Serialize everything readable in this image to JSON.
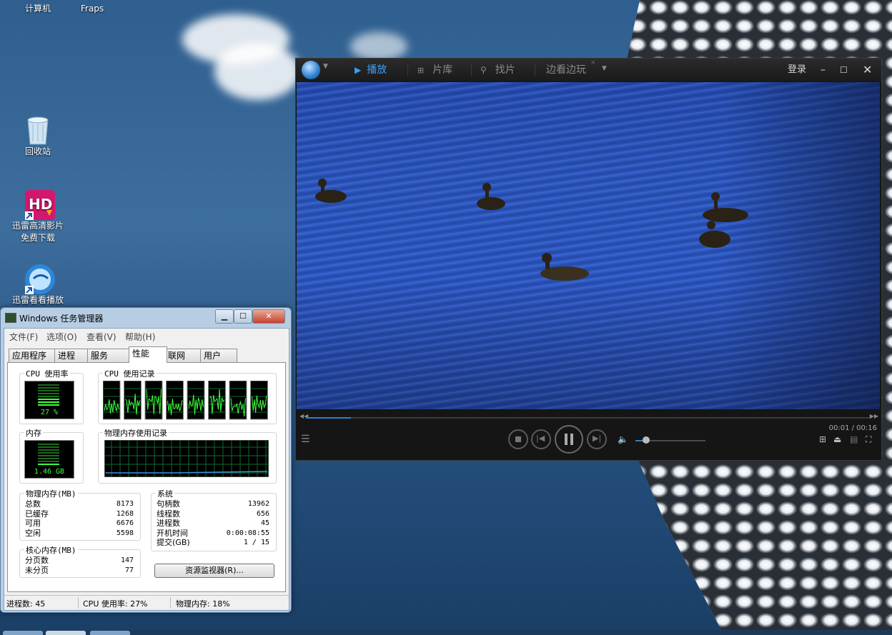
{
  "desktop": {
    "icons": [
      {
        "label": "计算机"
      },
      {
        "label": "Fraps"
      },
      {
        "label": "回收站"
      },
      {
        "label": "迅雷高清影片免费下载"
      },
      {
        "label": "迅雷看看播放"
      }
    ]
  },
  "taskmgr": {
    "title": "Windows 任务管理器",
    "menu": [
      "文件(F)",
      "选项(O)",
      "查看(V)",
      "帮助(H)"
    ],
    "tabs": [
      "应用程序",
      "进程",
      "服务",
      "性能",
      "联网",
      "用户"
    ],
    "active_tab": "性能",
    "cpu_usage_label": "CPU 使用率",
    "cpu_usage_value": "27 %",
    "cpu_history_label": "CPU 使用记录",
    "mem_label": "内存",
    "mem_value": "1.46 GB",
    "mem_history_label": "物理内存使用记录",
    "physical_memory": {
      "label": "物理内存(MB)",
      "rows": [
        {
          "k": "总数",
          "v": "8173"
        },
        {
          "k": "已缓存",
          "v": "1268"
        },
        {
          "k": "可用",
          "v": "6676"
        },
        {
          "k": "空闲",
          "v": "5598"
        }
      ]
    },
    "system": {
      "label": "系统",
      "rows": [
        {
          "k": "句柄数",
          "v": "13962"
        },
        {
          "k": "线程数",
          "v": "656"
        },
        {
          "k": "进程数",
          "v": "45"
        },
        {
          "k": "开机时间",
          "v": "0:00:08:55"
        },
        {
          "k": "提交(GB)",
          "v": "1 / 15"
        }
      ]
    },
    "kernel_memory": {
      "label": "核心内存(MB)",
      "rows": [
        {
          "k": "分页数",
          "v": "147"
        },
        {
          "k": "未分页",
          "v": "77"
        }
      ]
    },
    "resmon_button": "资源监视器(R)...",
    "status": {
      "processes": "进程数: 45",
      "cpu": "CPU 使用率: 27%",
      "memory": "物理内存: 18%"
    }
  },
  "player": {
    "tabs": [
      {
        "label": "播放",
        "icon": "play-icon"
      },
      {
        "label": "片库",
        "icon": "grid-icon"
      },
      {
        "label": "找片",
        "icon": "search-icon"
      },
      {
        "label": "边看边玩",
        "icon": ""
      }
    ],
    "login": "登录",
    "time": "00:01 / 00:16",
    "progress": 0.08,
    "volume": 0.15,
    "accent": "#3aa0ff"
  }
}
